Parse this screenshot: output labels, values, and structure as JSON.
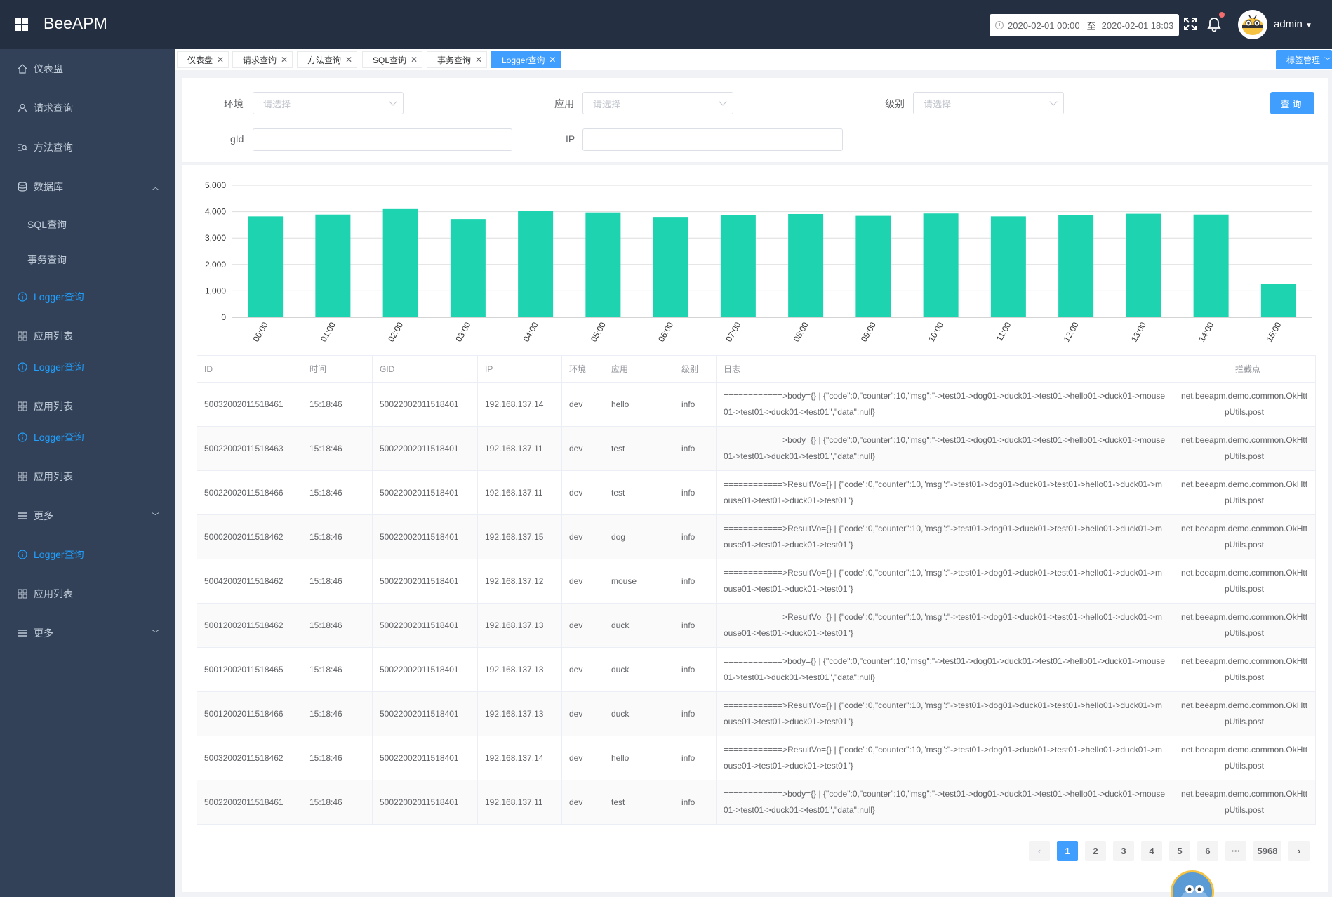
{
  "app": {
    "title": "BeeAPM"
  },
  "header": {
    "date_start": "2020-02-01 00:00",
    "date_sep": "至",
    "date_end": "2020-02-01 18:03",
    "username": "admin"
  },
  "sidebar": {
    "items": [
      {
        "label": "仪表盘",
        "icon": "home-icon"
      },
      {
        "label": "请求查询",
        "icon": "user-icon"
      },
      {
        "label": "方法查询",
        "icon": "search-list-icon"
      },
      {
        "label": "数据库",
        "icon": "database-icon"
      },
      {
        "label": "SQL查询"
      },
      {
        "label": "事务查询"
      },
      {
        "label": "Logger查询",
        "icon": "info-icon"
      },
      {
        "label": "应用列表",
        "icon": "grid-icon"
      },
      {
        "label": "Logger查询",
        "icon": "info-icon"
      },
      {
        "label": "应用列表",
        "icon": "grid-icon"
      },
      {
        "label": "Logger查询",
        "icon": "info-icon"
      },
      {
        "label": "应用列表",
        "icon": "grid-icon"
      },
      {
        "label": "更多",
        "icon": "menu-icon"
      },
      {
        "label": "Logger查询",
        "icon": "info-icon"
      },
      {
        "label": "应用列表",
        "icon": "grid-icon"
      },
      {
        "label": "更多",
        "icon": "menu-icon"
      }
    ]
  },
  "tags": [
    {
      "label": "仪表盘"
    },
    {
      "label": "请求查询"
    },
    {
      "label": "方法查询"
    },
    {
      "label": "SQL查询"
    },
    {
      "label": "事务查询"
    },
    {
      "label": "Logger查询",
      "active": true
    }
  ],
  "tag_manager": "标签管理",
  "filters": {
    "env_label": "环境",
    "app_label": "应用",
    "level_label": "级别",
    "select_placeholder": "请选择",
    "gid_label": "gId",
    "ip_label": "IP",
    "query_button": "查询"
  },
  "chart_data": {
    "type": "bar",
    "categories": [
      "00:00",
      "01:00",
      "02:00",
      "03:00",
      "04:00",
      "05:00",
      "06:00",
      "07:00",
      "08:00",
      "09:00",
      "10:00",
      "11:00",
      "12:00",
      "13:00",
      "14:00",
      "15:00"
    ],
    "values": [
      3820,
      3890,
      4100,
      3720,
      4030,
      3970,
      3800,
      3870,
      3910,
      3840,
      3930,
      3820,
      3880,
      3920,
      3890,
      1250
    ],
    "ylim": [
      0,
      5000
    ],
    "yticks": [
      "0",
      "1,000",
      "2,000",
      "3,000",
      "4,000",
      "5,000"
    ],
    "grid": true,
    "color": "#1ed3b0"
  },
  "table": {
    "columns": [
      "ID",
      "时间",
      "GID",
      "IP",
      "环境",
      "应用",
      "级别",
      "日志",
      "拦截点"
    ],
    "rows": [
      [
        "50032002011518461",
        "15:18:46",
        "50022002011518401",
        "192.168.137.14",
        "dev",
        "hello",
        "info",
        "============>body={} | {\"code\":0,\"counter\":10,\"msg\":\"->test01->dog01->duck01->test01->hello01->duck01->mouse01->test01->duck01->test01\",\"data\":null}",
        "net.beeapm.demo.common.OkHttpUtils.post"
      ],
      [
        "50022002011518463",
        "15:18:46",
        "50022002011518401",
        "192.168.137.11",
        "dev",
        "test",
        "info",
        "============>body={} | {\"code\":0,\"counter\":10,\"msg\":\"->test01->dog01->duck01->test01->hello01->duck01->mouse01->test01->duck01->test01\",\"data\":null}",
        "net.beeapm.demo.common.OkHttpUtils.post"
      ],
      [
        "50022002011518466",
        "15:18:46",
        "50022002011518401",
        "192.168.137.11",
        "dev",
        "test",
        "info",
        "============>ResultVo={} | {\"code\":0,\"counter\":10,\"msg\":\"->test01->dog01->duck01->test01->hello01->duck01->mouse01->test01->duck01->test01\"}",
        "net.beeapm.demo.common.OkHttpUtils.post"
      ],
      [
        "50002002011518462",
        "15:18:46",
        "50022002011518401",
        "192.168.137.15",
        "dev",
        "dog",
        "info",
        "============>ResultVo={} | {\"code\":0,\"counter\":10,\"msg\":\"->test01->dog01->duck01->test01->hello01->duck01->mouse01->test01->duck01->test01\"}",
        "net.beeapm.demo.common.OkHttpUtils.post"
      ],
      [
        "50042002011518462",
        "15:18:46",
        "50022002011518401",
        "192.168.137.12",
        "dev",
        "mouse",
        "info",
        "============>ResultVo={} | {\"code\":0,\"counter\":10,\"msg\":\"->test01->dog01->duck01->test01->hello01->duck01->mouse01->test01->duck01->test01\"}",
        "net.beeapm.demo.common.OkHttpUtils.post"
      ],
      [
        "50012002011518462",
        "15:18:46",
        "50022002011518401",
        "192.168.137.13",
        "dev",
        "duck",
        "info",
        "============>ResultVo={} | {\"code\":0,\"counter\":10,\"msg\":\"->test01->dog01->duck01->test01->hello01->duck01->mouse01->test01->duck01->test01\"}",
        "net.beeapm.demo.common.OkHttpUtils.post"
      ],
      [
        "50012002011518465",
        "15:18:46",
        "50022002011518401",
        "192.168.137.13",
        "dev",
        "duck",
        "info",
        "============>body={} | {\"code\":0,\"counter\":10,\"msg\":\"->test01->dog01->duck01->test01->hello01->duck01->mouse01->test01->duck01->test01\",\"data\":null}",
        "net.beeapm.demo.common.OkHttpUtils.post"
      ],
      [
        "50012002011518466",
        "15:18:46",
        "50022002011518401",
        "192.168.137.13",
        "dev",
        "duck",
        "info",
        "============>ResultVo={} | {\"code\":0,\"counter\":10,\"msg\":\"->test01->dog01->duck01->test01->hello01->duck01->mouse01->test01->duck01->test01\"}",
        "net.beeapm.demo.common.OkHttpUtils.post"
      ],
      [
        "50032002011518462",
        "15:18:46",
        "50022002011518401",
        "192.168.137.14",
        "dev",
        "hello",
        "info",
        "============>ResultVo={} | {\"code\":0,\"counter\":10,\"msg\":\"->test01->dog01->duck01->test01->hello01->duck01->mouse01->test01->duck01->test01\"}",
        "net.beeapm.demo.common.OkHttpUtils.post"
      ],
      [
        "50022002011518461",
        "15:18:46",
        "50022002011518401",
        "192.168.137.11",
        "dev",
        "test",
        "info",
        "============>body={} | {\"code\":0,\"counter\":10,\"msg\":\"->test01->dog01->duck01->test01->hello01->duck01->mouse01->test01->duck01->test01\",\"data\":null}",
        "net.beeapm.demo.common.OkHttpUtils.post"
      ]
    ]
  },
  "pagination": {
    "prev": "‹",
    "pages": [
      "1",
      "2",
      "3",
      "4",
      "5",
      "6"
    ],
    "current": "1",
    "ellipsis": "···",
    "last": "5968",
    "next": "›"
  },
  "colors": {
    "header_bg": "#242f42",
    "sidebar_bg": "#324157",
    "accent": "#409eff",
    "bar": "#1ed3b0"
  }
}
